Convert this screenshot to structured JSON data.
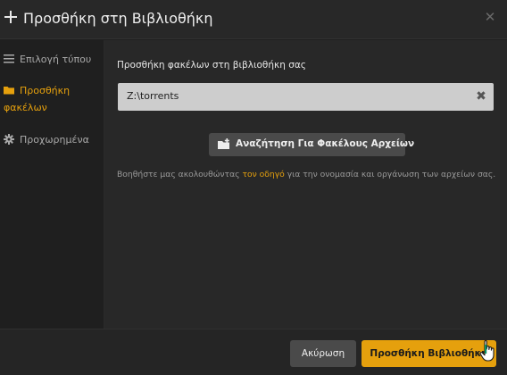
{
  "dialog": {
    "title": "Προσθήκη στη Βιβλιοθήκη",
    "close_glyph": "✕"
  },
  "sidebar": {
    "items": [
      {
        "label": "Επιλογή τύπου",
        "icon": "list-icon",
        "active": false
      },
      {
        "label_line1": "Προσθήκη",
        "label_line2": "φακέλων",
        "icon": "folder-icon",
        "active": true
      },
      {
        "label": "Προχωρημένα",
        "icon": "gear-icon",
        "active": false
      }
    ]
  },
  "main": {
    "section_label": "Προσθήκη φακέλων στη βιβλιοθήκη σας",
    "path_value": "Z:\\torrents",
    "clear_glyph": "✖",
    "browse_button": "Αναζήτηση Για Φακέλους Αρχείων",
    "help_prefix": "Βοηθήστε μας ακολουθώντας ",
    "help_link": "τον οδηγό",
    "help_suffix": " για την ονομασία και οργάνωση των αρχείων σας."
  },
  "footer": {
    "cancel_label": "Ακύρωση",
    "add_label": "Προσθήκη Βιβλιοθήκη"
  },
  "colors": {
    "accent": "#e5a00d",
    "background": "#1f1f1f",
    "panel": "#282828",
    "button": "#4a4a4a"
  }
}
